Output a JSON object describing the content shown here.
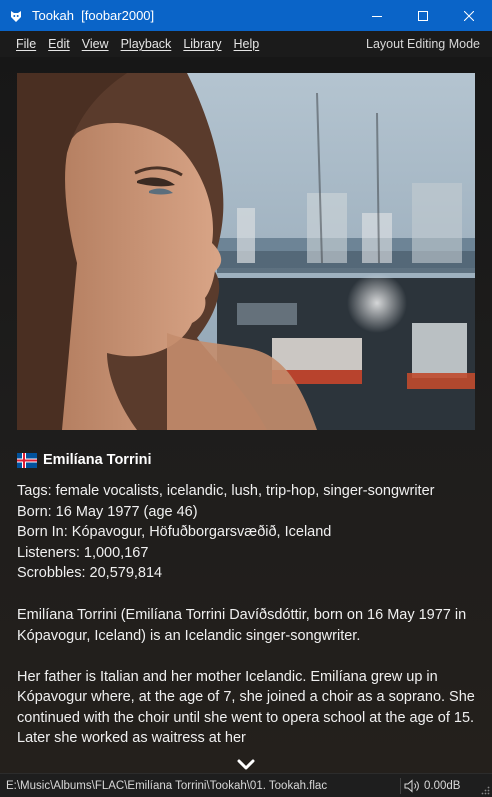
{
  "window": {
    "title": "Tookah  [foobar2000]",
    "minimize_icon": "minimize-icon",
    "maximize_icon": "maximize-icon",
    "close_icon": "close-icon"
  },
  "menu": {
    "items": [
      "File",
      "Edit",
      "View",
      "Playback",
      "Library",
      "Help"
    ],
    "layout_mode": "Layout Editing Mode"
  },
  "artist": {
    "flag": "iceland-flag-icon",
    "name": "Emilíana Torrini",
    "tags": "Tags: female vocalists, icelandic, lush, trip-hop, singer-songwriter",
    "born": "Born: 16 May 1977 (age 46)",
    "born_in": "Born In: Kópavogur, Höfuðborgarsvæðið, Iceland",
    "listeners": "Listeners: 1,000,167",
    "scrobbles": "Scrobbles: 20,579,814"
  },
  "bio": {
    "para1": "Emilíana Torrini (Emilíana Torrini Davíðsdóttir, born on 16 May 1977 in Kópavogur, Iceland) is an Icelandic singer-songwriter.",
    "para2": "Her father is Italian and her mother Icelandic. Emilíana grew up in Kópavogur where, at the age of 7, she joined a choir as a soprano. She continued with the choir until she went to opera school at the age of 15. Later she worked as waitress at her"
  },
  "status": {
    "path": "E:\\Music\\Albums\\FLAC\\Emilíana Torrini\\Tookah\\01. Tookah.flac",
    "volume": "0.00dB"
  },
  "colors": {
    "titlebar": "#0a64c8",
    "menubar": "#1b1b1b",
    "panel": "#1c1b1a",
    "text": "#f0f0f0"
  }
}
